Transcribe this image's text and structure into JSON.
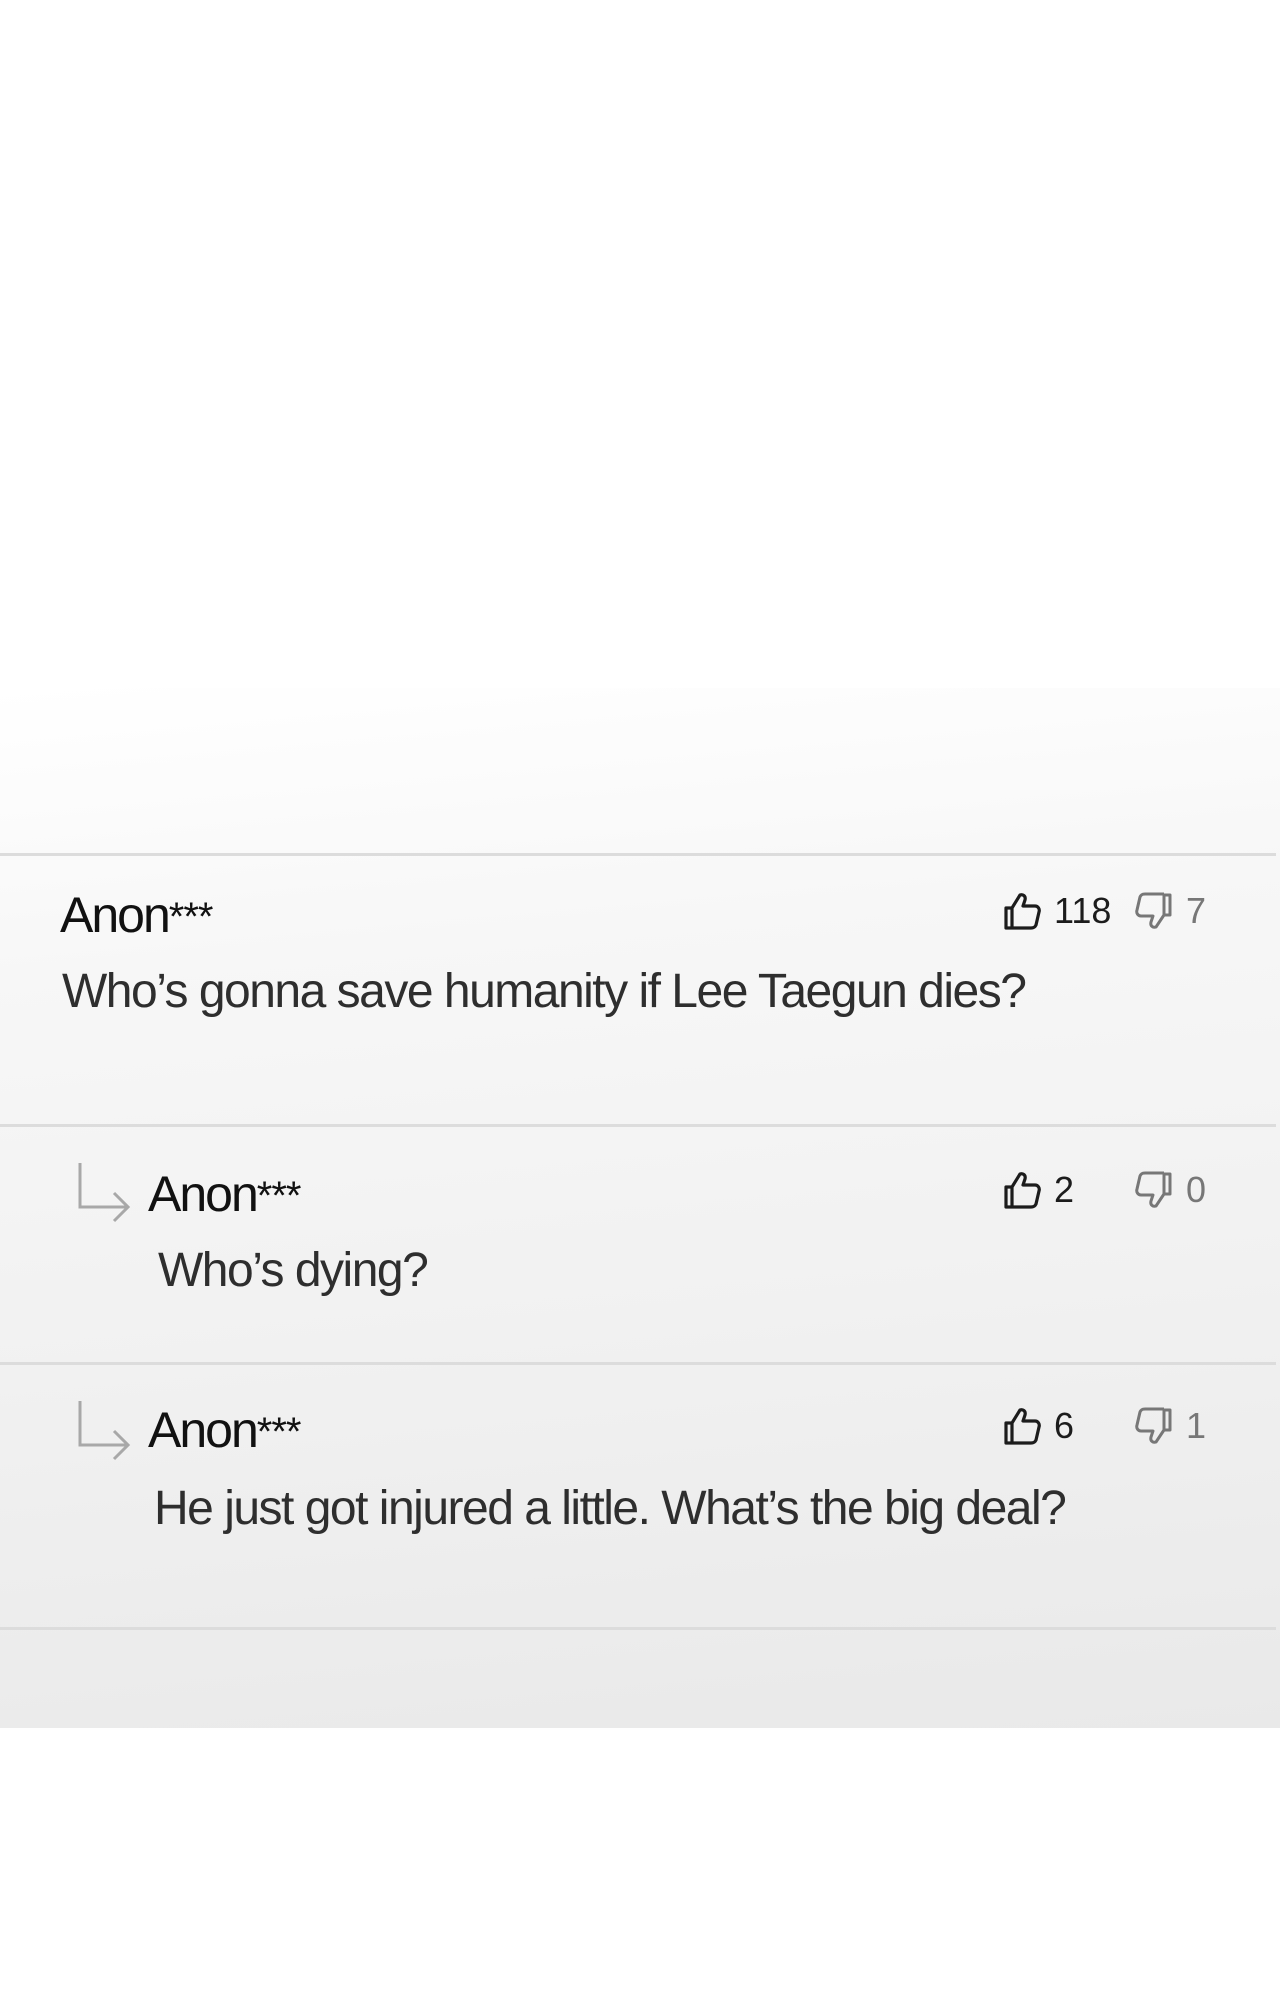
{
  "comments": [
    {
      "author": "Anon",
      "author_mask": "***",
      "text": "Who’s gonna save humanity if Lee Taegun dies?",
      "likes": "118",
      "dislikes": "7",
      "is_reply": false
    },
    {
      "author": "Anon",
      "author_mask": "***",
      "text": "Who’s dying?",
      "likes": "2",
      "dislikes": "0",
      "is_reply": true
    },
    {
      "author": "Anon",
      "author_mask": "***",
      "text": "He just got injured a little. What’s the big deal?",
      "likes": "6",
      "dislikes": "1",
      "is_reply": true
    }
  ],
  "icons": {
    "like": "thumbs-up-icon",
    "dislike": "thumbs-down-icon",
    "reply": "reply-arrow-icon"
  },
  "colors": {
    "divider": "#dcdcdc",
    "author": "#111111",
    "text": "#2e2e2e",
    "like_icon": "#1c1c1c",
    "dislike_icon": "#777777",
    "reply_arrow": "#a8a8a8"
  }
}
